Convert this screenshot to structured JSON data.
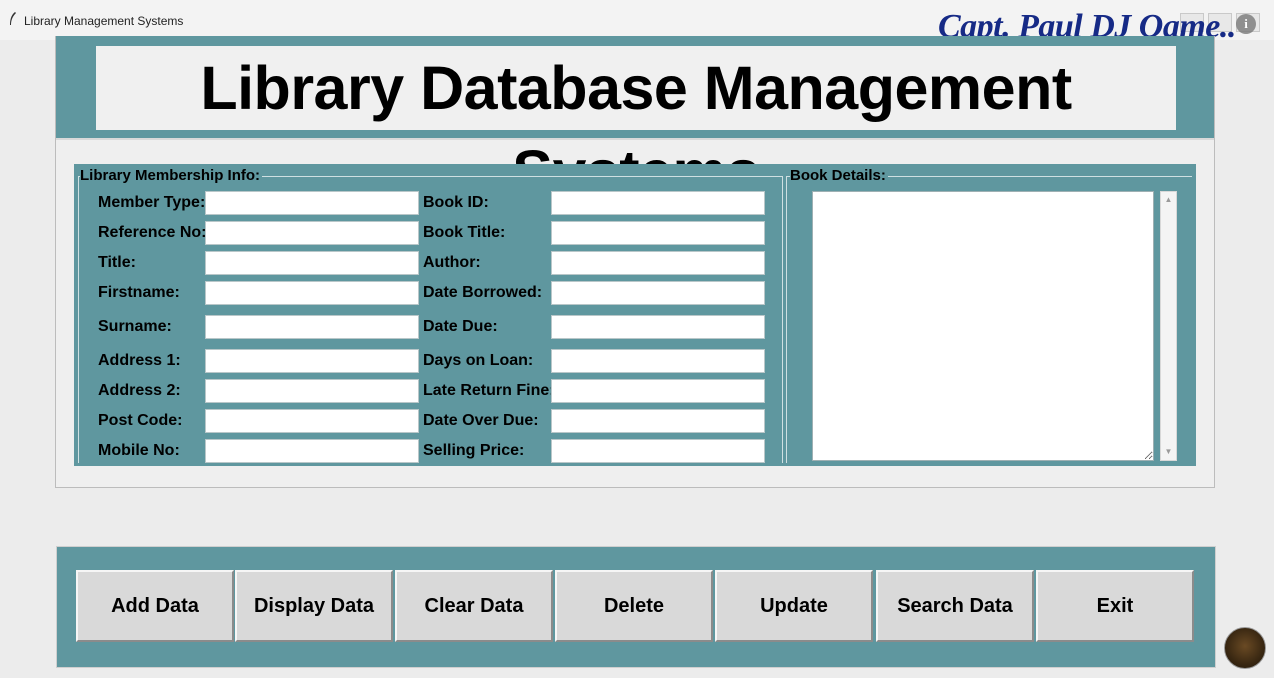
{
  "window": {
    "title": "Library Management Systems"
  },
  "watermark": "Capt. Paul DJ Oame..",
  "header": {
    "title": "Library Database Management Systems"
  },
  "membership": {
    "group_label": "Library Membership Info:",
    "fields": [
      {
        "label": "Member Type:",
        "value": ""
      },
      {
        "label": "Reference No:",
        "value": ""
      },
      {
        "label": "Title:",
        "value": ""
      },
      {
        "label": "Firstname:",
        "value": ""
      },
      {
        "label": "Surname:",
        "value": ""
      },
      {
        "label": "Address 1:",
        "value": ""
      },
      {
        "label": "Address 2:",
        "value": ""
      },
      {
        "label": "Post Code:",
        "value": ""
      },
      {
        "label": "Mobile No:",
        "value": ""
      }
    ],
    "book_fields": [
      {
        "label": "Book ID:",
        "value": ""
      },
      {
        "label": "Book Title:",
        "value": ""
      },
      {
        "label": "Author:",
        "value": ""
      },
      {
        "label": "Date Borrowed:",
        "value": ""
      },
      {
        "label": "Date Due:",
        "value": ""
      },
      {
        "label": "Days on Loan:",
        "value": ""
      },
      {
        "label": "Late Return Fine:",
        "value": ""
      },
      {
        "label": "Date Over Due:",
        "value": ""
      },
      {
        "label": "Selling Price:",
        "value": ""
      }
    ]
  },
  "book_details": {
    "group_label": "Book Details:"
  },
  "buttons": {
    "add": "Add Data",
    "display": "Display Data",
    "clear": "Clear Data",
    "delete": "Delete",
    "update": "Update",
    "search": "Search Data",
    "exit": "Exit"
  },
  "icons": {
    "app": "feather-icon",
    "info": "info-icon",
    "scroll_up": "scroll-up-arrow-icon",
    "scroll_down": "scroll-down-arrow-icon",
    "channel_logo": "channel-logo-icon"
  },
  "colors": {
    "panel": "#5f979f",
    "watermark": "#162a86",
    "button_face": "#d9d9d9"
  }
}
